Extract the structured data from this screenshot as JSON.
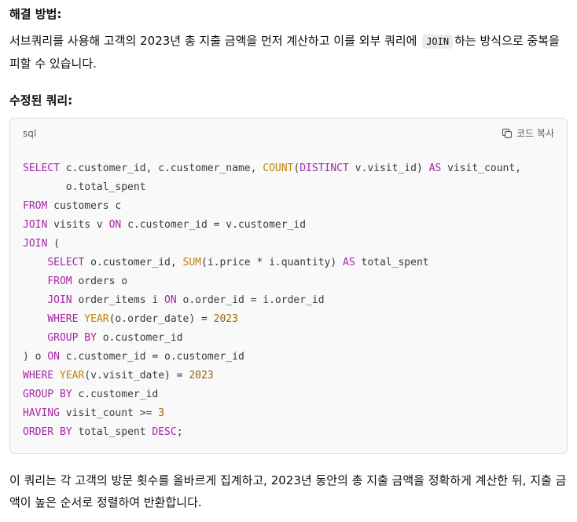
{
  "solution": {
    "heading": "해결 방법:",
    "text_before": "서브쿼리를 사용해 고객의 2023년 총 지출 금액을 먼저 계산하고 이를 외부 쿼리에 ",
    "inline_code": "JOIN",
    "text_after": "하는 방식으로 중복을 피할 수 있습니다."
  },
  "query": {
    "heading": "수정된 쿼리:",
    "language": "sql",
    "copy_label": "코드 복사",
    "lines": [
      [
        {
          "t": "SELECT",
          "c": "kw"
        },
        {
          "t": " c.customer_id, c.customer_name, "
        },
        {
          "t": "COUNT",
          "c": "fn"
        },
        {
          "t": "("
        },
        {
          "t": "DISTINCT",
          "c": "kw"
        },
        {
          "t": " v.visit_id) "
        },
        {
          "t": "AS",
          "c": "kw"
        },
        {
          "t": " visit_count,"
        }
      ],
      [
        {
          "t": "       o.total_spent"
        }
      ],
      [
        {
          "t": "FROM",
          "c": "kw"
        },
        {
          "t": " customers c"
        }
      ],
      [
        {
          "t": "JOIN",
          "c": "kw"
        },
        {
          "t": " visits v "
        },
        {
          "t": "ON",
          "c": "kw"
        },
        {
          "t": " c.customer_id = v.customer_id"
        }
      ],
      [
        {
          "t": "JOIN",
          "c": "kw"
        },
        {
          "t": " ("
        }
      ],
      [
        {
          "t": "    "
        },
        {
          "t": "SELECT",
          "c": "kw"
        },
        {
          "t": " o.customer_id, "
        },
        {
          "t": "SUM",
          "c": "fn"
        },
        {
          "t": "(i.price * i.quantity) "
        },
        {
          "t": "AS",
          "c": "kw"
        },
        {
          "t": " total_spent"
        }
      ],
      [
        {
          "t": "    "
        },
        {
          "t": "FROM",
          "c": "kw"
        },
        {
          "t": " orders o"
        }
      ],
      [
        {
          "t": "    "
        },
        {
          "t": "JOIN",
          "c": "kw"
        },
        {
          "t": " order_items i "
        },
        {
          "t": "ON",
          "c": "kw"
        },
        {
          "t": " o.order_id = i.order_id"
        }
      ],
      [
        {
          "t": "    "
        },
        {
          "t": "WHERE",
          "c": "kw"
        },
        {
          "t": " "
        },
        {
          "t": "YEAR",
          "c": "fn"
        },
        {
          "t": "(o.order_date) = "
        },
        {
          "t": "2023",
          "c": "num"
        }
      ],
      [
        {
          "t": "    "
        },
        {
          "t": "GROUP BY",
          "c": "kw"
        },
        {
          "t": " o.customer_id"
        }
      ],
      [
        {
          "t": ") o "
        },
        {
          "t": "ON",
          "c": "kw"
        },
        {
          "t": " c.customer_id = o.customer_id"
        }
      ],
      [
        {
          "t": "WHERE",
          "c": "kw"
        },
        {
          "t": " "
        },
        {
          "t": "YEAR",
          "c": "fn"
        },
        {
          "t": "(v.visit_date) = "
        },
        {
          "t": "2023",
          "c": "num"
        }
      ],
      [
        {
          "t": "GROUP BY",
          "c": "kw"
        },
        {
          "t": " c.customer_id"
        }
      ],
      [
        {
          "t": "HAVING",
          "c": "kw"
        },
        {
          "t": " visit_count >= "
        },
        {
          "t": "3",
          "c": "num"
        }
      ],
      [
        {
          "t": "ORDER BY",
          "c": "kw"
        },
        {
          "t": " total_spent "
        },
        {
          "t": "DESC",
          "c": "kw"
        },
        {
          "t": ";"
        }
      ]
    ]
  },
  "summary": {
    "text": "이 쿼리는 각 고객의 방문 횟수를 올바르게 집계하고, 2023년 동안의 총 지출 금액을 정확하게 계산한 뒤, 지출 금액이 높은 순서로 정렬하여 반환합니다."
  },
  "colors": {
    "keyword": "#a626a4",
    "function": "#c18401",
    "number": "#986801"
  },
  "icons": {
    "copy": "copy-icon"
  }
}
